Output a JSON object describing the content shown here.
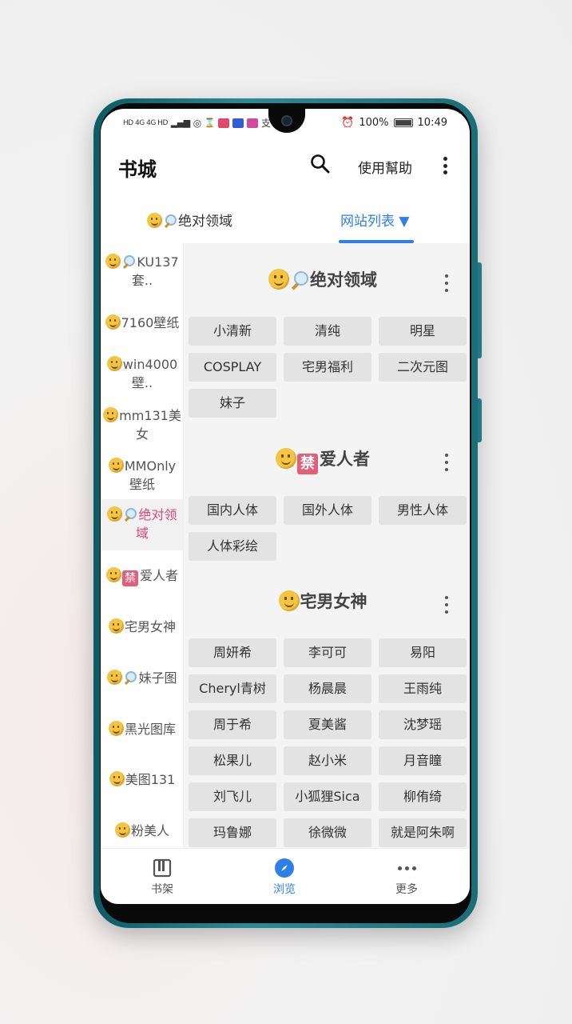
{
  "status": {
    "left_icons": "HD 4G 4G HD",
    "battery": "100%",
    "time": "10:49"
  },
  "appbar": {
    "title": "书城",
    "help": "使用幫助"
  },
  "tabs": {
    "tab1": "绝对领域",
    "tab2": "网站列表 ▼"
  },
  "sidebar": {
    "items": [
      {
        "label": "KU137套..",
        "icons": [
          "smiley",
          "magnifier"
        ]
      },
      {
        "label": "7160壁纸",
        "icons": [
          "smiley"
        ]
      },
      {
        "label": "win4000壁..",
        "icons": [
          "smiley"
        ]
      },
      {
        "label": "mm131美女",
        "icons": [
          "smiley"
        ]
      },
      {
        "label": "MMOnly壁纸",
        "icons": [
          "smiley"
        ]
      },
      {
        "label": "绝对领域",
        "icons": [
          "smiley",
          "magnifier"
        ],
        "active": true
      },
      {
        "label": "爱人者",
        "icons": [
          "smiley",
          "ban"
        ]
      },
      {
        "label": "宅男女神",
        "icons": [
          "smiley"
        ]
      },
      {
        "label": "妹子图",
        "icons": [
          "smiley",
          "magnifier"
        ]
      },
      {
        "label": "黑光图库",
        "icons": [
          "smiley"
        ]
      },
      {
        "label": "美图131",
        "icons": [
          "smiley"
        ]
      },
      {
        "label": "粉美人",
        "icons": [
          "smiley"
        ]
      }
    ],
    "l0a": "KU137",
    "l0b": "套..",
    "l1": "7160壁纸",
    "l2a": "win4000",
    "l2b": "壁..",
    "l3a": "mm131美",
    "l3b": "女",
    "l4a": "MMOnly",
    "l4b": "壁纸",
    "l5a": "绝对领",
    "l5b": "域",
    "l6": "爱人者",
    "l7": "宅男女神",
    "l8": "妹子图",
    "l9": "黑光图库",
    "l10": "美图131",
    "l11": "粉美人"
  },
  "sections": {
    "s1": {
      "title": "绝对领域",
      "chips": [
        "小清新",
        "清纯",
        "明星",
        "COSPLAY",
        "宅男福利",
        "二次元图",
        "妹子"
      ]
    },
    "s2": {
      "title": "爱人者",
      "chips": [
        "国内人体",
        "国外人体",
        "男性人体",
        "人体彩绘"
      ]
    },
    "s3": {
      "title": "宅男女神",
      "chips": [
        "周妍希",
        "李可可",
        "易阳",
        "Cheryl青树",
        "杨晨晨",
        "王雨纯",
        "周于希",
        "夏美酱",
        "沈梦瑶",
        "松果儿",
        "赵小米",
        "月音瞳",
        "刘飞儿",
        "小狐狸Sica",
        "柳侑绮",
        "玛鲁娜",
        "徐微微",
        "就是阿朱啊"
      ]
    }
  },
  "bottomnav": {
    "shelf": "书架",
    "browse": "浏览",
    "more": "更多"
  },
  "colors": {
    "accent": "#2f7fe8",
    "active_side": "#e0457a",
    "phone_frame": "#1b6d77"
  },
  "icons": [
    "search-icon",
    "more-vert-icon",
    "bookshelf-icon",
    "compass-icon",
    "more-horiz-icon",
    "smiley-icon",
    "magnifier-icon",
    "ban-icon"
  ]
}
